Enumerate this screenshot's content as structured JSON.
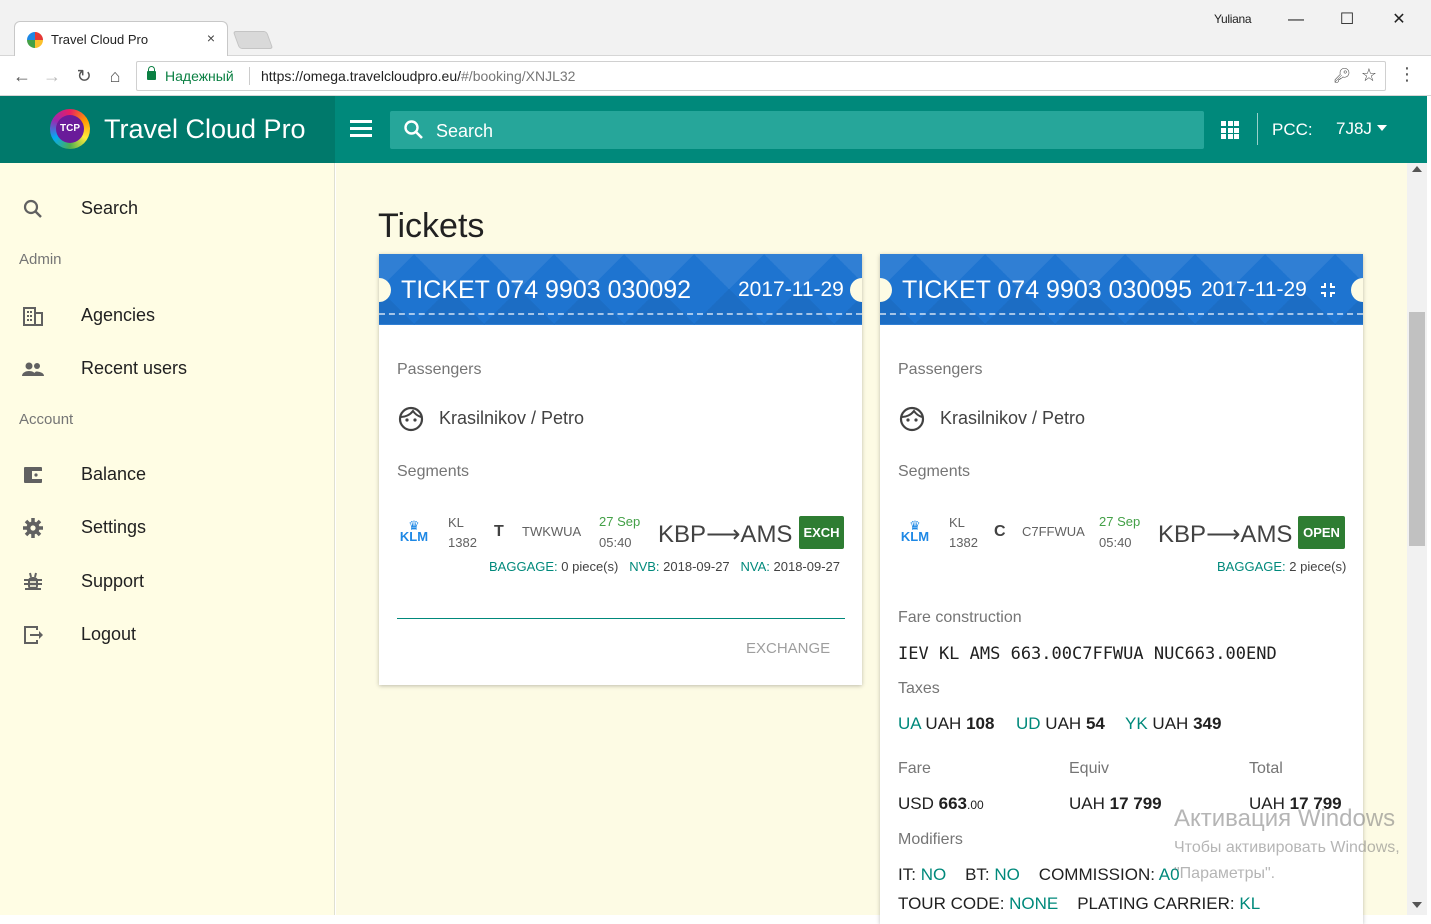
{
  "browser": {
    "tab_title": "Travel Cloud Pro",
    "tab_close": "×",
    "window_user": "Yuliana",
    "window_min": "—",
    "window_max": "☐",
    "window_close": "✕",
    "secure_label": "Надежный",
    "url_host": "https://omega.travelcloudpro.eu/",
    "url_path": "#/booking/XNJL32"
  },
  "header": {
    "logo_text": "TCP",
    "brand": "Travel Cloud Pro",
    "search_placeholder": "Search",
    "pcc_label": "PCC:",
    "pcc_value": "7J8J"
  },
  "sidebar": {
    "items": [
      {
        "label": "Search",
        "icon": "search-icon"
      },
      {
        "label": "Agencies",
        "icon": "building-icon"
      },
      {
        "label": "Recent users",
        "icon": "people-icon"
      },
      {
        "label": "Balance",
        "icon": "wallet-icon"
      },
      {
        "label": "Settings",
        "icon": "gear-icon"
      },
      {
        "label": "Support",
        "icon": "bug-icon"
      },
      {
        "label": "Logout",
        "icon": "logout-icon"
      }
    ],
    "sections": {
      "admin": "Admin",
      "account": "Account"
    }
  },
  "main": {
    "title": "Tickets",
    "tickets": [
      {
        "number": "TICKET  074 9903 030092",
        "date": "2017-11-29",
        "passengers_label": "Passengers",
        "passenger": "Krasilnikov / Petro",
        "segments_label": "Segments",
        "segment": {
          "airline_logo": "KLM",
          "carrier": "KL",
          "flight": "1382",
          "class": "T",
          "fare_basis": "TWKWUA",
          "date": "27 Sep",
          "time": "05:40",
          "route": "KBP⟶AMS",
          "status": "EXCH",
          "baggage_key": "BAGGAGE:",
          "baggage_val": "0 piece(s)",
          "nvb_key": "NVB:",
          "nvb_val": "2018-09-27",
          "nva_key": "NVA:",
          "nva_val": "2018-09-27"
        },
        "action": "EXCHANGE"
      },
      {
        "number": "TICKET  074 9903 030095",
        "date": "2017-11-29",
        "passengers_label": "Passengers",
        "passenger": "Krasilnikov / Petro",
        "segments_label": "Segments",
        "segment": {
          "airline_logo": "KLM",
          "carrier": "KL",
          "flight": "1382",
          "class": "C",
          "fare_basis": "C7FFWUA",
          "date": "27 Sep",
          "time": "05:40",
          "route": "KBP⟶AMS",
          "status": "OPEN",
          "baggage_key": "BAGGAGE:",
          "baggage_val": "2 piece(s)"
        },
        "fare_construction_label": "Fare construction",
        "fare_construction": "IEV KL AMS 663.00C7FFWUA NUC663.00END",
        "taxes_label": "Taxes",
        "taxes": [
          {
            "code": "UA",
            "cur": "UAH",
            "amount": "108"
          },
          {
            "code": "UD",
            "cur": "UAH",
            "amount": "54"
          },
          {
            "code": "YK",
            "cur": "UAH",
            "amount": "349"
          }
        ],
        "fare_label": "Fare",
        "equiv_label": "Equiv",
        "total_label": "Total",
        "fare_cur": "USD",
        "fare_amount": "663",
        "fare_cents": ".00",
        "equiv_cur": "UAH",
        "equiv_amount": "17 799",
        "total_cur": "UAH",
        "total_amount": "17 799",
        "modifiers_label": "Modifiers",
        "mod_it_key": "IT:",
        "mod_it_val": "NO",
        "mod_bt_key": "BT:",
        "mod_bt_val": "NO",
        "mod_comm_key": "COMMISSION:",
        "mod_comm_val": "A0",
        "mod_tour_key": "TOUR CODE:",
        "mod_tour_val": "NONE",
        "mod_plating_key": "PLATING CARRIER:",
        "mod_plating_val": "KL"
      }
    ]
  },
  "watermark": {
    "title": "Активация Windows",
    "sub": "Чтобы активировать Windows,",
    "sub2": "\"Параметры\"."
  },
  "colors": {
    "header": "#00897b",
    "brand_bg": "#00796b",
    "sidebar_bg": "#fffde4",
    "ticket_head": "#1e74d0",
    "status_green": "#2e7d32"
  }
}
